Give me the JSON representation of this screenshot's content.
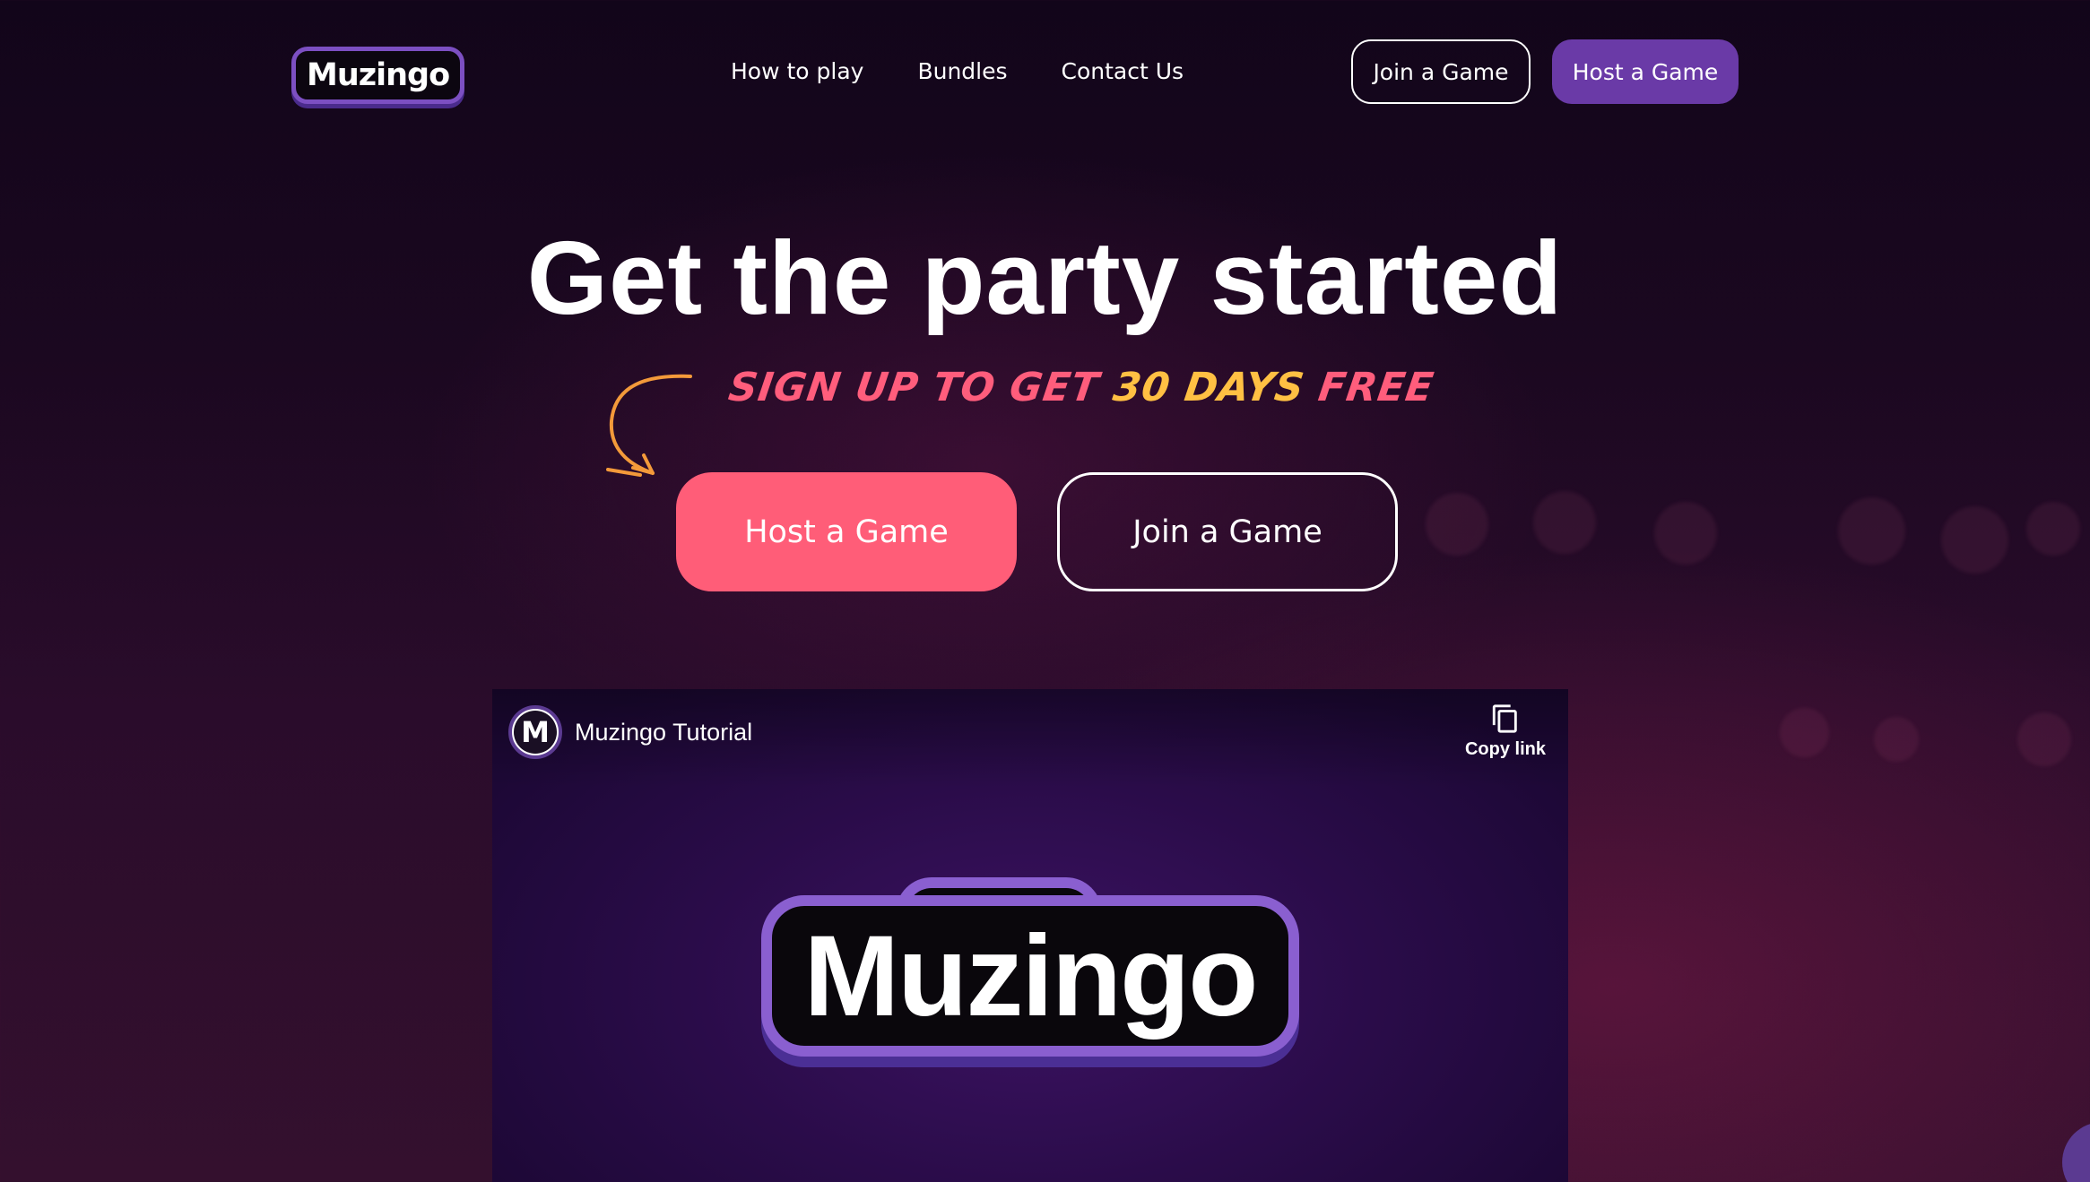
{
  "brand": {
    "name": "Muzingo"
  },
  "nav": {
    "items": [
      {
        "label": "How to play"
      },
      {
        "label": "Bundles"
      },
      {
        "label": "Contact Us"
      }
    ]
  },
  "header": {
    "join_label": "Join a Game",
    "host_label": "Host a Game"
  },
  "hero": {
    "title": "Get the party started",
    "promo_part1": "SIGN UP TO GET ",
    "promo_part2": "30 DAYS",
    "promo_part3": " FREE",
    "host_label": "Host a Game",
    "join_label": "Join a Game"
  },
  "video": {
    "channel_initial": "M",
    "title": "Muzingo Tutorial",
    "copy_link_label": "Copy link",
    "logo_text": "Muzingo"
  },
  "colors": {
    "accent_pink": "#ff5d78",
    "accent_purple": "#6a3aa7",
    "promo_yellow": "#ffc043",
    "arrow_orange": "#f39a3a"
  }
}
